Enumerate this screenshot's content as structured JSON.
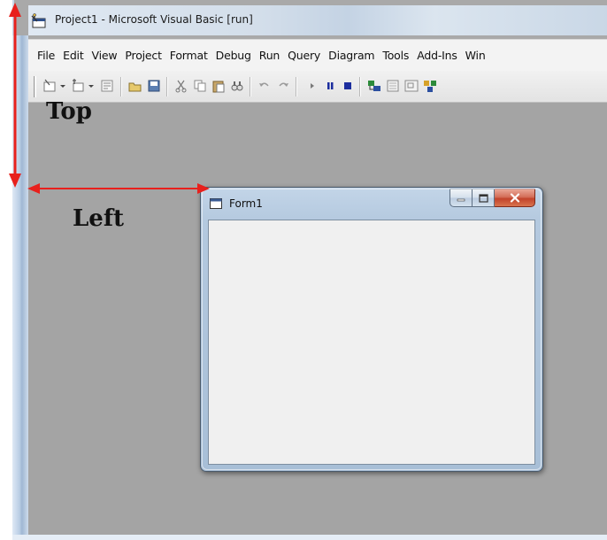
{
  "ide": {
    "title": "Project1 - Microsoft Visual Basic [run]",
    "menu": [
      "File",
      "Edit",
      "View",
      "Project",
      "Format",
      "Debug",
      "Run",
      "Query",
      "Diagram",
      "Tools",
      "Add-Ins",
      "Win"
    ],
    "toolbar_icons": [
      "add-project-icon",
      "add-form-icon",
      "menu-editor-icon",
      "open-project-icon",
      "save-project-icon",
      "cut-icon",
      "copy-icon",
      "paste-icon",
      "find-icon",
      "undo-icon",
      "redo-icon",
      "start-icon",
      "break-icon",
      "end-icon",
      "project-explorer-icon",
      "properties-window-icon",
      "form-layout-icon",
      "object-browser-icon"
    ]
  },
  "form": {
    "title": "Form1",
    "buttons": [
      "minimize",
      "maximize",
      "close"
    ]
  },
  "annotations": {
    "top_label": "Top",
    "left_label": "Left",
    "arrow_color": "#e8201c"
  },
  "colors": {
    "workspace": "#a4a4a4",
    "form_client": "#f0f0f0",
    "close_button": "#c2432b"
  }
}
